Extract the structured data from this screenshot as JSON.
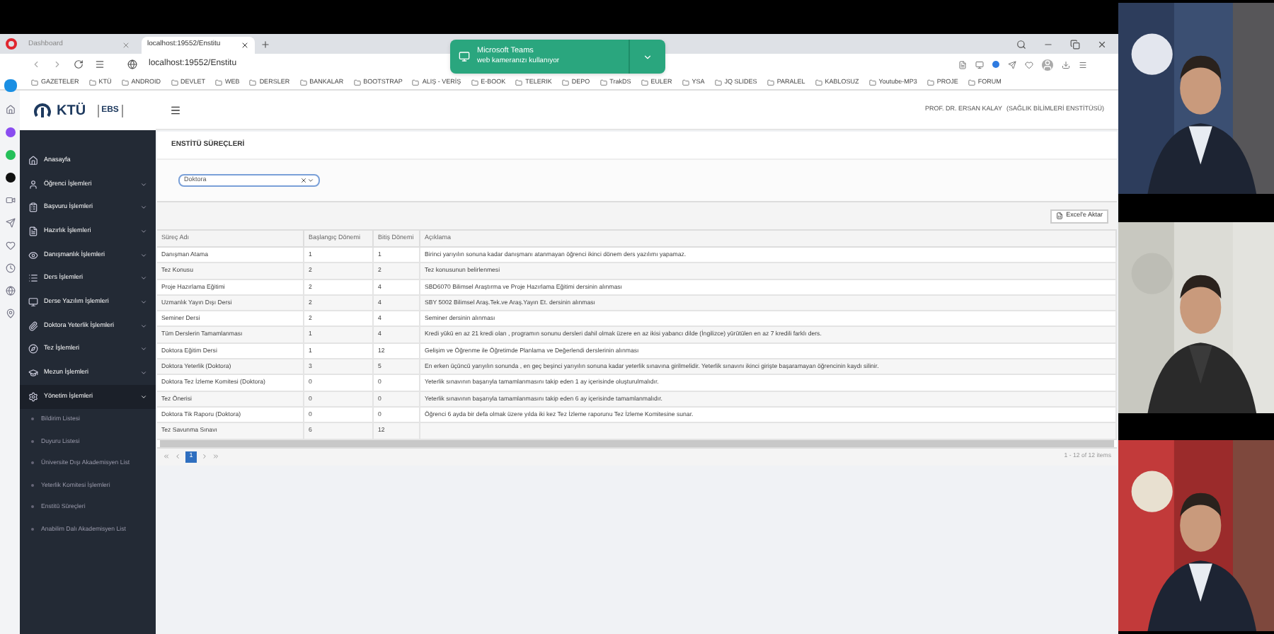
{
  "browser": {
    "tabs": [
      {
        "label": "Dashboard",
        "selected": false
      },
      {
        "label": "localhost:19552/Enstitu",
        "selected": true
      }
    ],
    "address": "localhost:19552/Enstitu",
    "bookmarks": [
      "GAZETELER",
      "KTÜ",
      "ANDROID",
      "DEVLET",
      "WEB",
      "DERSLER",
      "BANKALAR",
      "BOOTSTRAP",
      "ALIŞ - VERİŞ",
      "E-BOOK",
      "TELERIK",
      "DEPO",
      "TrakDS",
      "EULER",
      "YSA",
      "JQ SLIDES",
      "PARALEL",
      "KABLOSUZ",
      "Youtube-MP3",
      "PROJE",
      "FORUM"
    ]
  },
  "notification": {
    "title": "Microsoft Teams",
    "text": "web kameranızı kullanıyor"
  },
  "logo": {
    "name": "KTÜ",
    "system": "EBS"
  },
  "header": {
    "user": "PROF. DR. ERSAN KALAY",
    "unit": "(SAĞLIK BİLİMLERİ ENSTİTÜSÜ)"
  },
  "sidebar": {
    "items": [
      {
        "label": "Anasayfa"
      },
      {
        "label": "Öğrenci İşlemleri",
        "expanded": false
      },
      {
        "label": "Başvuru İşlemleri",
        "expanded": false
      },
      {
        "label": "Hazırlık İşlemleri",
        "expanded": false
      },
      {
        "label": "Danışmanlık İşlemleri",
        "expanded": false
      },
      {
        "label": "Ders İşlemleri",
        "expanded": false
      },
      {
        "label": "Derse Yazılım İşlemleri",
        "expanded": false
      },
      {
        "label": "Doktora Yeterlik İşlemleri",
        "expanded": false
      },
      {
        "label": "Tez İşlemleri",
        "expanded": false
      },
      {
        "label": "Mezun İşlemleri",
        "expanded": false
      },
      {
        "label": "Yönetim İşlemleri",
        "expanded": true,
        "children": [
          {
            "label": "Bildirim Listesi"
          },
          {
            "label": "Duyuru Listesi"
          },
          {
            "label": "Üniversite Dışı Akademisyen List"
          },
          {
            "label": "Yeterlik Komitesi İşlemleri"
          },
          {
            "label": "Enstitü Süreçleri"
          },
          {
            "label": "Anabilim Dalı Akademisyen List"
          }
        ]
      }
    ]
  },
  "page": {
    "title": "ENSTİTÜ SÜREÇLERİ",
    "filter": {
      "value": "Doktora"
    },
    "export_button": "Excel'e Aktar"
  },
  "table": {
    "columns": [
      "Süreç Adı",
      "Başlangıç Dönemi",
      "Bitiş Dönemi",
      "Açıklama"
    ],
    "rows": [
      [
        "Danışman Atama",
        "1",
        "1",
        "Birinci yarıyılın sonuna kadar danışmanı atanmayan öğrenci ikinci dönem ders yazılımı yapamaz."
      ],
      [
        "Tez Konusu",
        "2",
        "2",
        "Tez konusunun belirlenmesi"
      ],
      [
        "Proje Hazırlama Eğitimi",
        "2",
        "4",
        "SBD6070 Bilimsel Araştırma ve Proje Hazırlama Eğitimi dersinin alınması"
      ],
      [
        "Uzmanlık Yayın Dışı Dersi",
        "2",
        "4",
        "SBY 5002 Bilimsel Araş.Tek.ve Araş.Yayın Et. dersinin alınması"
      ],
      [
        "Seminer Dersi",
        "2",
        "4",
        "Seminer dersinin alınması"
      ],
      [
        "Tüm Derslerin Tamamlanması",
        "1",
        "4",
        "Kredi yükü en az 21 kredi olan , programın sonunu dersleri dahil olmak üzere en az ikisi yabancı dilde (İngilizce) yürütülen en az 7 kredili farklı ders."
      ],
      [
        "Doktora Eğitim Dersi",
        "1",
        "12",
        "Gelişim ve Öğrenme ile Öğretimde Planlama ve Değerlendi derslerinin alınması"
      ],
      [
        "Doktora Yeterlik (Doktora)",
        "3",
        "5",
        "En erken üçüncü yarıyılın sonunda , en geç beşinci yarıyılın sonuna kadar yeterlik sınavına girilmelidir. Yeterlik sınavını ikinci girişte başaramayan öğrencinin kaydı silinir."
      ],
      [
        "Doktora Tez İzleme Komitesi (Doktora)",
        "0",
        "0",
        "Yeterlik sınavının başarıyla tamamlanmasını takip eden 1 ay içerisinde oluşturulmalıdır."
      ],
      [
        "Tez Önerisi",
        "0",
        "0",
        "Yeterlik sınavının başarıyla tamamlanmasını takip eden 6 ay içerisinde tamamlanmalıdır."
      ],
      [
        "Doktora Tik Raporu (Doktora)",
        "0",
        "0",
        "Öğrenci 6 ayda bir defa olmak üzere yılda iki kez Tez İzleme raporunu Tez İzleme Komitesine sunar."
      ],
      [
        "Tez Savunma Sınavı",
        "6",
        "12",
        ""
      ]
    ]
  },
  "pager": {
    "pages": [
      {
        "label": "1",
        "selected": true
      }
    ],
    "summary": "1 - 12 of 12 items"
  }
}
